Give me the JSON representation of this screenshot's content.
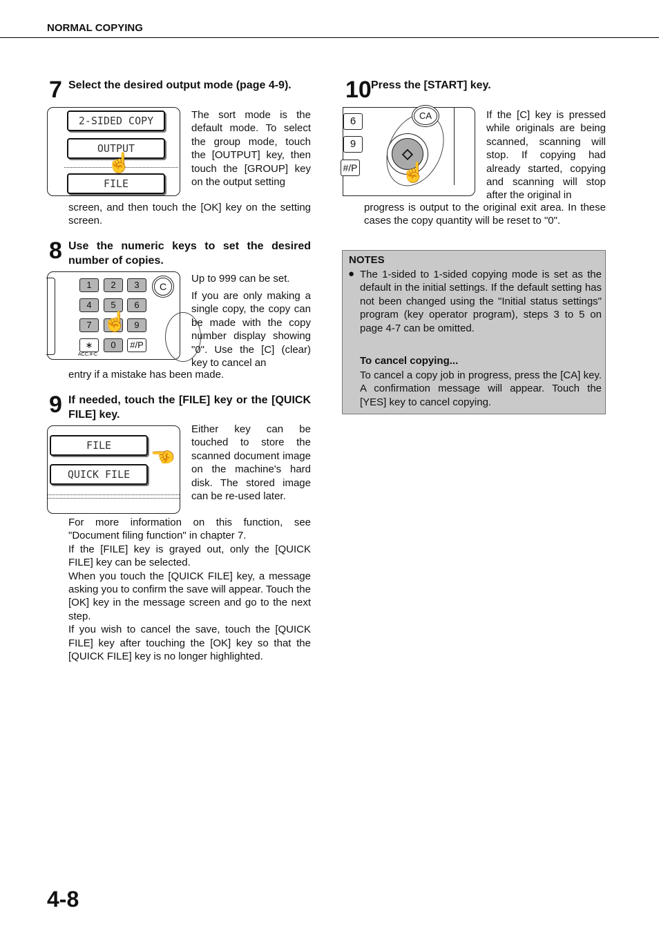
{
  "header": {
    "section": "NORMAL COPYING"
  },
  "steps": [
    {
      "number": "7",
      "title": "Select the desired output mode (page 4-9).",
      "side": "The sort mode is the default mode. To select the group mode, touch the [OUTPUT] key, then touch the [GROUP] key on the output setting",
      "rest": "screen, and then touch the [OK] key on the setting screen.",
      "buttons": [
        "2-SIDED COPY",
        "OUTPUT",
        "FILE"
      ]
    },
    {
      "number": "8",
      "title": "Use the numeric keys to set the desired number of copies.",
      "side_lead": "Up to 999 can be set.",
      "side": "If you are only making a single copy, the copy can be made with the copy number display showing \"0\". Use the [C] (clear) key to cancel an",
      "rest": "entry if a mistake has been made.",
      "keys": [
        "1",
        "2",
        "3",
        "4",
        "5",
        "6",
        "7",
        "8",
        "9",
        "∗",
        "0",
        "#/P"
      ],
      "clear_key": "C",
      "acc_label": "ACC.#-C"
    },
    {
      "number": "9",
      "title": "If needed, touch the [FILE] key or the [QUICK FILE] key.",
      "side": "Either key can be touched to store the scanned document image on the machine's hard disk. The stored image can be re-used later.",
      "rest": [
        "For more information on this function, see \"Document filing function\" in chapter 7.",
        "If the [FILE] key is grayed out, only the [QUICK FILE] key can be selected.",
        "When you touch the [QUICK FILE] key, a message asking you to confirm the save will appear. Touch the [OK] key in the message screen and go to the next step.",
        "If you wish to cancel the save, touch the [QUICK FILE] key after touching the [OK] key so that the [QUICK FILE] key is no longer highlighted."
      ],
      "buttons": [
        "FILE",
        "QUICK FILE"
      ]
    },
    {
      "number": "10",
      "title": "Press the [START] key.",
      "side": "If the [C] key is pressed while originals are being scanned, scanning will stop. If copying had already started, copying and scanning will stop after the original in",
      "rest": "progress is output to the original exit area. In these cases the copy quantity will be reset to \"0\".",
      "keys": [
        "6",
        "9",
        "#/P"
      ],
      "ca_key": "CA",
      "start_symbol": "◇"
    }
  ],
  "notes": {
    "heading": "NOTES",
    "bullet": "The 1-sided to 1-sided copying mode is set as the default in the initial settings. If the default setting has not been changed using the \"Initial status settings\" program (key operator program), steps 3 to 5 on page 4-7 can be omitted.",
    "cancel_heading": "To cancel copying...",
    "cancel_text": "To cancel a copy job in progress, press the [CA] key. A confirmation message will appear. Touch the [YES] key to cancel copying."
  },
  "page_number": "4-8",
  "colors": {
    "notes_bg": "#c9c9c9",
    "key_gray": "#b5b5b5"
  }
}
